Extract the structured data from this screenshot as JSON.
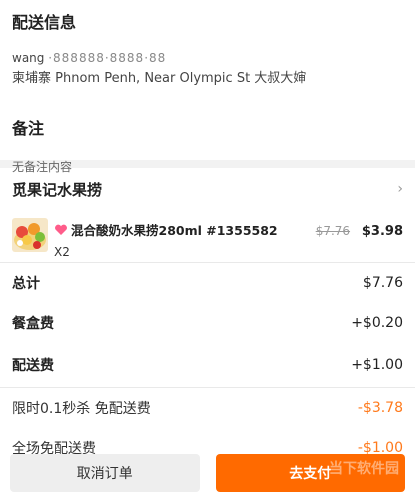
{
  "delivery": {
    "title": "配送信息",
    "name": "wang",
    "phone": "·888888·8888·88",
    "address": "柬埔寨 Phnom Penh, Near Olympic St 大叔大婶"
  },
  "note": {
    "title": "备注",
    "value": "无备注内容"
  },
  "shop": {
    "name": "觅果记水果捞",
    "chevron": "›"
  },
  "item": {
    "name": "混合酸奶水果捞280ml #1355582",
    "qty": "X2",
    "original_price": "$7.76",
    "price": "$3.98",
    "image_icon": "fruit-bowl-icon"
  },
  "fees": [
    {
      "label": "总计",
      "value": "$7.76"
    },
    {
      "label": "餐盒费",
      "value": "+$0.20"
    },
    {
      "label": "配送费",
      "value": "+$1.00"
    }
  ],
  "promos": [
    {
      "label": "限时0.1秒杀 免配送费",
      "value": "-$3.78"
    },
    {
      "label": "全场免配送费",
      "value": "-$1.00"
    }
  ],
  "actions": {
    "cancel": "取消订单",
    "pay": "去支付"
  },
  "watermark": "当下软件园",
  "colors": {
    "accent": "#ff6a00",
    "promo": "#ff7a1c"
  }
}
